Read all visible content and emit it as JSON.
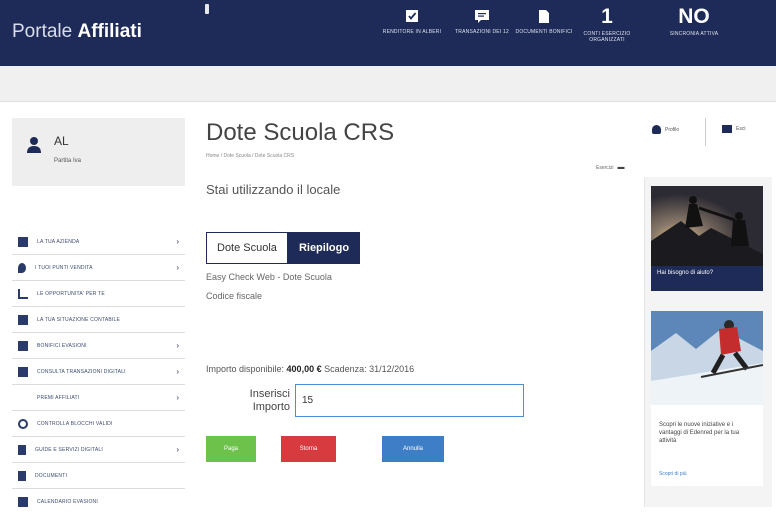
{
  "header": {
    "logo_light": "Portale ",
    "logo_bold": "Affiliati",
    "nav": [
      {
        "icon": "check-square-icon",
        "value": "",
        "label": "RENDITORE IN ALBERI"
      },
      {
        "icon": "chat-icon",
        "value": "",
        "label": "TRANSAZIONI DEI 12"
      },
      {
        "icon": "document-icon",
        "value": "",
        "label": "DOCUMENTI BONIFICI"
      },
      {
        "icon": "",
        "value": "1",
        "label": "CONTI ESERCIZIO ORGANIZZATI"
      },
      {
        "icon": "",
        "value": "NO",
        "label": "SINCRONIA ATTIVA"
      }
    ]
  },
  "user": {
    "name": "AL",
    "role": "Partita Iva"
  },
  "sidebar": {
    "items": [
      {
        "label": "LA TUA AZIENDA",
        "chevron": true,
        "icon": true
      },
      {
        "label": "I TUOI PUNTI VENDITA",
        "chevron": true,
        "icon": true
      },
      {
        "label": "LE OPPORTUNITA' PER TE",
        "chevron": false,
        "icon": true
      },
      {
        "label": "LA TUA SITUAZIONE CONTABILE",
        "chevron": false,
        "icon": true
      },
      {
        "label": "BONIFICI EVASIONI",
        "chevron": true,
        "icon": true
      },
      {
        "label": "CONSULTA TRANSAZIONI DIGITALI",
        "chevron": true,
        "icon": true
      },
      {
        "label": "PREMI AFFILIATI",
        "chevron": true,
        "icon": false
      },
      {
        "label": "CONTROLLA BLOCCHI VALIDI",
        "chevron": false,
        "icon": true
      },
      {
        "label": "GUIDE E SERVIZI DIGITALI",
        "chevron": true,
        "icon": true
      },
      {
        "label": "DOCUMENTI",
        "chevron": false,
        "icon": true
      },
      {
        "label": "CALENDARIO EVASIONI",
        "chevron": false,
        "icon": true
      }
    ]
  },
  "main": {
    "title": "Dote Scuola CRS",
    "breadcrumb": "Home  /  Dote Scuola  /  Dote Scuola CRS",
    "stai": "Stai utilizzando il locale",
    "tabs": [
      {
        "label": "Dote Scuola",
        "active": false
      },
      {
        "label": "Riepilogo",
        "active": true
      }
    ],
    "info1": "Easy Check Web - Dote Scuola",
    "info2": "Codice fiscale",
    "importo_prefix": "Importo disponibile: ",
    "importo_value": "400,00 €",
    "importo_suffix": " Scadenza: 31/12/2016",
    "input_label_1": "Inserisci",
    "input_label_2": "Importo",
    "input_value": "15",
    "buttons": {
      "green": "Paga",
      "red": "Storna",
      "blue": "Annulla"
    }
  },
  "right": {
    "link1": "Profilo",
    "link2": "Esci",
    "esci_dropdown": "Esercizi",
    "card1_caption": "Hai bisogno di aiuto?",
    "card2_text": "Scopri le nuove iniziative e i vantaggi di Edenred per la tua attività",
    "card2_link": "Scopri di più"
  }
}
